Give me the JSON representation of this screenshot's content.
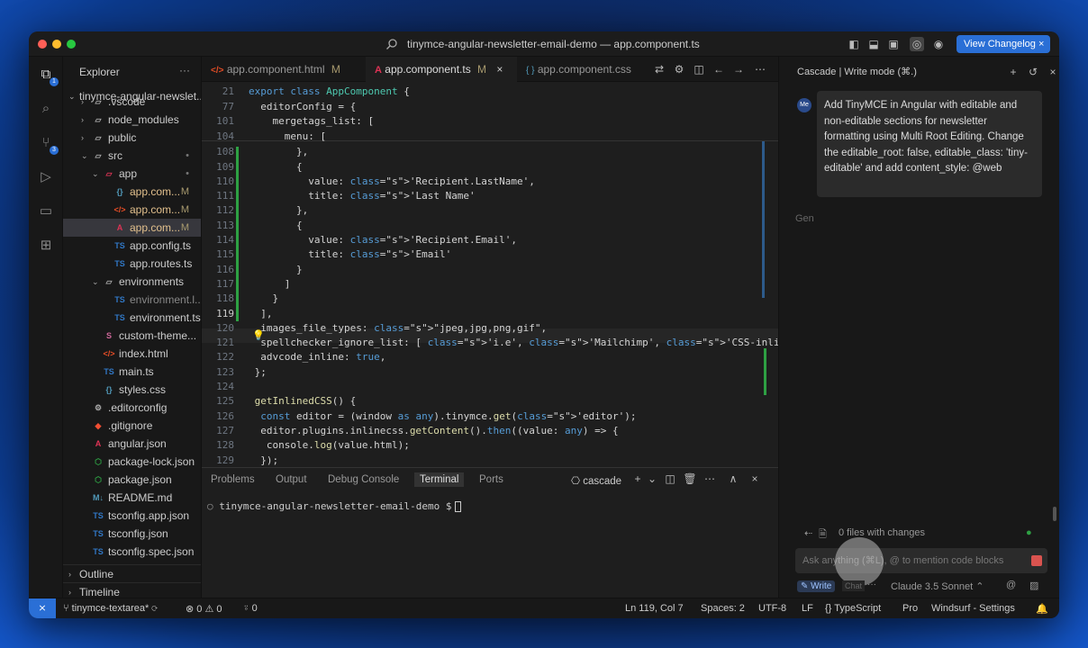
{
  "window": {
    "title": "tinymce-angular-newsletter-email-demo — app.component.ts",
    "changelog": "View Changelog ×"
  },
  "activity_badges": {
    "explorer": "1",
    "scm": "3"
  },
  "explorer": {
    "title": "Explorer",
    "more": "···",
    "root": "tinymce-angular-newslet...",
    "items": [
      {
        "label": ".vscode",
        "icon": "folder",
        "depth": 1,
        "chev": "›",
        "status": ""
      },
      {
        "label": "node_modules",
        "icon": "folder",
        "depth": 1,
        "chev": "›",
        "status": ""
      },
      {
        "label": "public",
        "icon": "folder",
        "depth": 1,
        "chev": "›",
        "status": ""
      },
      {
        "label": "src",
        "icon": "folder",
        "depth": 1,
        "chev": "⌄",
        "status": "•"
      },
      {
        "label": "app",
        "icon": "folder-app",
        "depth": 2,
        "chev": "⌄",
        "status": "•"
      },
      {
        "label": "app.com...",
        "icon": "css",
        "depth": 3,
        "chev": "",
        "status": "M"
      },
      {
        "label": "app.com...",
        "icon": "html",
        "depth": 3,
        "chev": "",
        "status": "M"
      },
      {
        "label": "app.com...",
        "icon": "angular",
        "depth": 3,
        "chev": "",
        "status": "M"
      },
      {
        "label": "app.config.ts",
        "icon": "ts",
        "depth": 3,
        "chev": "",
        "status": ""
      },
      {
        "label": "app.routes.ts",
        "icon": "ts",
        "depth": 3,
        "chev": "",
        "status": ""
      },
      {
        "label": "environments",
        "icon": "folder",
        "depth": 2,
        "chev": "⌄",
        "status": ""
      },
      {
        "label": "environment.l...",
        "icon": "ts",
        "depth": 3,
        "chev": "",
        "status": ""
      },
      {
        "label": "environment.ts",
        "icon": "ts",
        "depth": 3,
        "chev": "",
        "status": ""
      },
      {
        "label": "custom-theme...",
        "icon": "scss",
        "depth": 2,
        "chev": "",
        "status": ""
      },
      {
        "label": "index.html",
        "icon": "html",
        "depth": 2,
        "chev": "",
        "status": ""
      },
      {
        "label": "main.ts",
        "icon": "ts",
        "depth": 2,
        "chev": "",
        "status": ""
      },
      {
        "label": "styles.css",
        "icon": "css",
        "depth": 2,
        "chev": "",
        "status": ""
      },
      {
        "label": ".editorconfig",
        "icon": "gear",
        "depth": 1,
        "chev": "",
        "status": ""
      },
      {
        "label": ".gitignore",
        "icon": "git",
        "depth": 1,
        "chev": "",
        "status": ""
      },
      {
        "label": "angular.json",
        "icon": "angular",
        "depth": 1,
        "chev": "",
        "status": ""
      },
      {
        "label": "package-lock.json",
        "icon": "npm",
        "depth": 1,
        "chev": "",
        "status": ""
      },
      {
        "label": "package.json",
        "icon": "npm",
        "depth": 1,
        "chev": "",
        "status": ""
      },
      {
        "label": "README.md",
        "icon": "md",
        "depth": 1,
        "chev": "",
        "status": ""
      },
      {
        "label": "tsconfig.app.json",
        "icon": "tsconfig",
        "depth": 1,
        "chev": "",
        "status": ""
      },
      {
        "label": "tsconfig.json",
        "icon": "tsconfig",
        "depth": 1,
        "chev": "",
        "status": ""
      },
      {
        "label": "tsconfig.spec.json",
        "icon": "tsconfig",
        "depth": 1,
        "chev": "",
        "status": ""
      }
    ],
    "outline": "Outline",
    "timeline": "Timeline"
  },
  "tabs": [
    {
      "label": "app.component.html",
      "status": "M",
      "icon": "html"
    },
    {
      "label": "app.component.ts",
      "status": "M",
      "icon": "angular"
    },
    {
      "label": "app.component.css",
      "status": "",
      "icon": "css"
    }
  ],
  "code_lines": [
    {
      "n": "21",
      "t": "export class AppComponent {"
    },
    {
      "n": "77",
      "t": "  editorConfig = {"
    },
    {
      "n": "101",
      "t": "    mergetags_list: ["
    },
    {
      "n": "104",
      "t": "      menu: ["
    },
    {
      "n": "108",
      "t": "        },"
    },
    {
      "n": "109",
      "t": "        {"
    },
    {
      "n": "110",
      "t": "          value: 'Recipient.LastName',"
    },
    {
      "n": "111",
      "t": "          title: 'Last Name'"
    },
    {
      "n": "112",
      "t": "        },"
    },
    {
      "n": "113",
      "t": "        {"
    },
    {
      "n": "114",
      "t": "          value: 'Recipient.Email',"
    },
    {
      "n": "115",
      "t": "          title: 'Email'"
    },
    {
      "n": "116",
      "t": "        }"
    },
    {
      "n": "117",
      "t": "      ]"
    },
    {
      "n": "118",
      "t": "    }"
    },
    {
      "n": "119",
      "t": "  ],"
    },
    {
      "n": "120",
      "t": "  images_file_types: \"jpeg,jpg,png,gif\","
    },
    {
      "n": "121",
      "t": "  spellchecker_ignore_list: [ 'i.e', 'Mailchimp', 'CSS-inlined' ],"
    },
    {
      "n": "122",
      "t": "  advcode_inline: true,"
    },
    {
      "n": "123",
      "t": " };"
    },
    {
      "n": "124",
      "t": ""
    },
    {
      "n": "125",
      "t": " getInlinedCSS() {"
    },
    {
      "n": "126",
      "t": "  const editor = (window as any).tinymce.get('editor');"
    },
    {
      "n": "127",
      "t": "  editor.plugins.inlinecss.getContent().then((value: any) => {"
    },
    {
      "n": "128",
      "t": "   console.log(value.html);"
    },
    {
      "n": "129",
      "t": "  });"
    }
  ],
  "panel": {
    "tabs": [
      "Problems",
      "Output",
      "Debug Console",
      "Terminal",
      "Ports"
    ],
    "active": "Terminal",
    "terminal_name": "cascade",
    "prompt": "tinymce-angular-newsletter-email-demo $"
  },
  "cascade": {
    "title": "Cascade | Write mode (⌘.)",
    "avatar": "Me",
    "message": "Add TinyMCE in Angular with editable and non-editable sections for newsletter formatting using Multi Root Editing. Change the editable_root: false, editable_class: 'tiny-editable' and add content_style: @web",
    "generating": "Gen",
    "files_changed": "0 files with changes",
    "input_placeholder": "Ask anything (⌘L), @ to mention code blocks",
    "mode_write": "Write",
    "mode_chat": "Chat",
    "model": "Claude 3.5 Sonnet"
  },
  "status": {
    "branch": "tinymce-textarea*",
    "errors": "0",
    "warnings": "0",
    "ports": "0",
    "position": "Ln 119, Col 7",
    "spaces": "Spaces: 2",
    "encoding": "UTF-8",
    "eol": "LF",
    "language": "TypeScript",
    "pro": "Pro",
    "settings": "Windsurf - Settings"
  }
}
